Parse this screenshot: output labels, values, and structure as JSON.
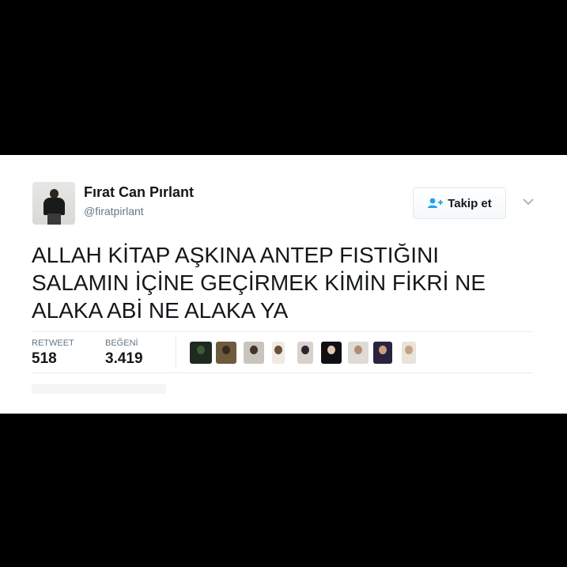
{
  "tweet": {
    "author": {
      "display_name": "Fırat Can Pırlant",
      "handle": "@firatpirlant"
    },
    "follow_button_label": "Takip et",
    "text": "ALLAH KİTAP AŞKINA ANTEP FISTIĞINI SALAMIN İÇİNE GEÇİRMEK KİMİN FİKRİ NE ALAKA ABİ NE ALAKA YA",
    "stats": {
      "retweet_label": "RETWEET",
      "retweet_count": "518",
      "like_label": "BEĞENİ",
      "like_count": "3.419"
    },
    "liker_avatar_count": 9
  },
  "colors": {
    "background": "#000000",
    "card": "#ffffff",
    "text": "#14171a",
    "muted": "#657786",
    "follow_icon": "#1da1f2"
  },
  "icons": [
    "follow-user-icon",
    "chevron-down-icon"
  ]
}
